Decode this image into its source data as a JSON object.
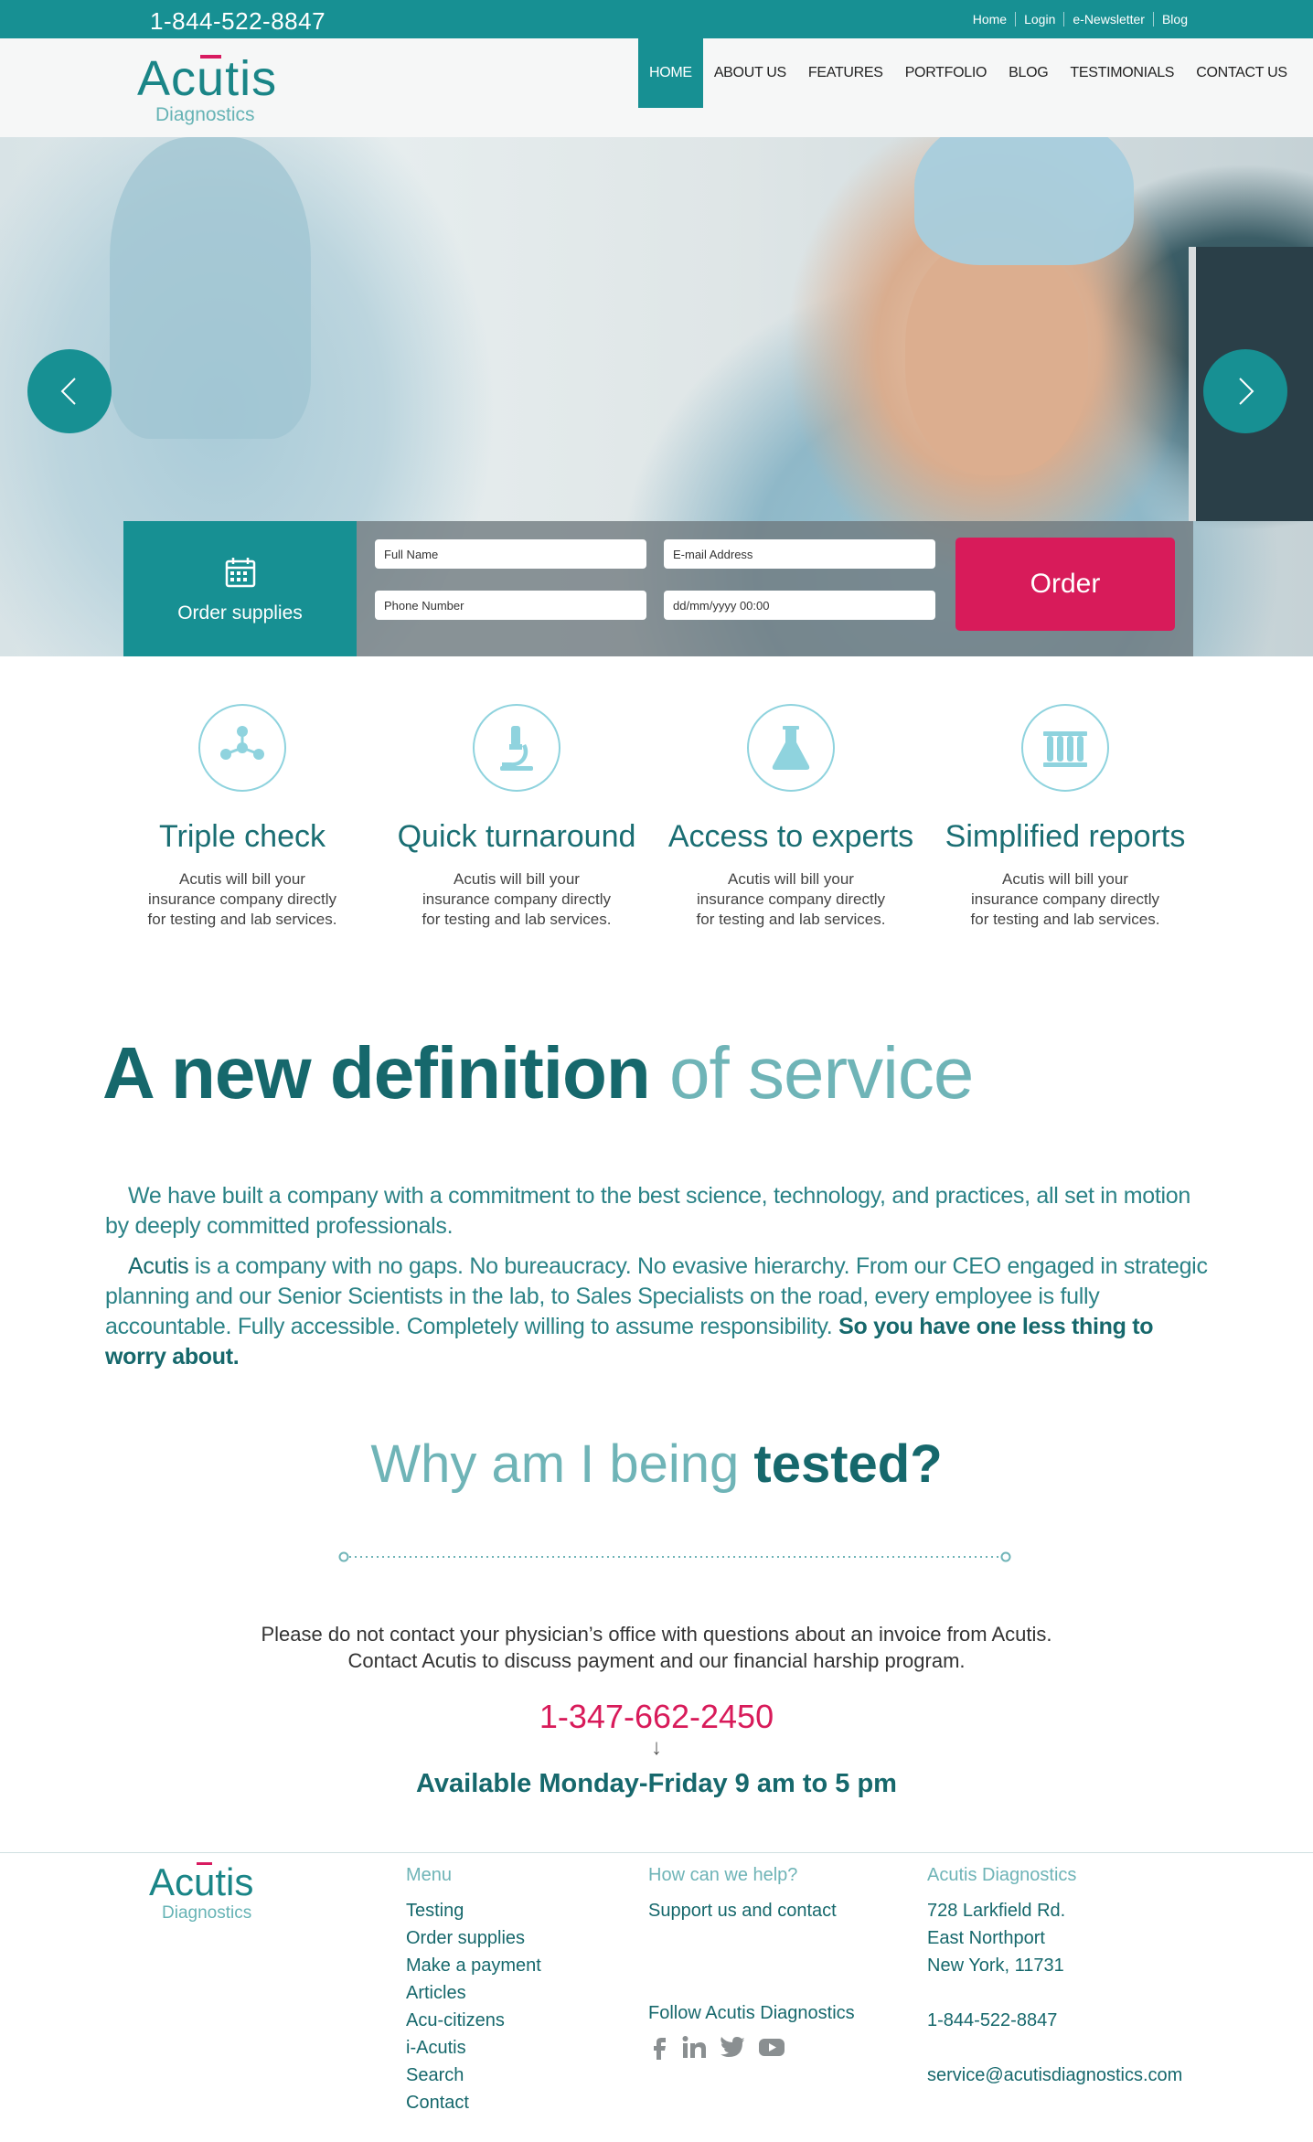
{
  "topbar": {
    "phone": "1-844-522-8847",
    "links": [
      "Home",
      "Login",
      "e-Newsletter",
      "Blog"
    ]
  },
  "header": {
    "logo_main": "Acūtis",
    "logo_sub": "Diagnostics",
    "nav": [
      "HOME",
      "ABOUT US",
      "FEATURES",
      "PORTFOLIO",
      "BLOG",
      "TESTIMONIALS",
      "CONTACT US"
    ],
    "active_nav": "HOME"
  },
  "hero": {
    "prev_icon": "chevron-left-icon",
    "next_icon": "chevron-right-icon",
    "order_tile": {
      "icon": "calendar-icon",
      "label": "Order supplies"
    },
    "fields": {
      "full_name": "Full Name",
      "email": "E-mail Address",
      "phone": "Phone Number",
      "datetime": "dd/mm/yyyy 00:00"
    },
    "order_button": "Order"
  },
  "features": [
    {
      "icon": "molecule-icon",
      "title": "Triple check",
      "desc": "Acutis will bill your insurance company directly for testing and lab services."
    },
    {
      "icon": "microscope-icon",
      "title": "Quick turnaround",
      "desc": "Acutis will bill your insurance company directly for testing and lab services."
    },
    {
      "icon": "flask-icon",
      "title": "Access to experts",
      "desc": "Acutis will bill your insurance company directly for testing and lab services."
    },
    {
      "icon": "test-tubes-icon",
      "title": "Simplified reports",
      "desc": "Acutis will bill your insurance company directly for testing and lab services."
    }
  ],
  "definition": {
    "title_strong": "A new definition",
    "title_light": "of service",
    "para1": "We have built a company with a commitment to the best science, technology, and practices, all set in motion by deeply committed professionals.",
    "para2_brand": "Acutis",
    "para2_body": " is a company with no gaps. No bureaucracy. No evasive hierarchy. From our CEO engaged in strategic planning and our Senior Scientists in the lab, to Sales Specialists on the road, every employee is fully accountable. Fully accessible. Completely willing to assume responsibility. ",
    "para2_end": "So you have one less thing to worry about."
  },
  "why": {
    "title_light": "Why am I being",
    "title_strong": "tested?",
    "line1": "Please do not contact your physician’s office with questions about an invoice from Acutis.",
    "line2": "Contact Acutis to discuss payment and our financial harship program.",
    "phone": "1-347-662-2450",
    "arrow": "↓",
    "availability": "Available Monday-Friday 9 am to 5 pm"
  },
  "footer": {
    "logo_main": "Acūtis",
    "logo_sub": "Diagnostics",
    "menu_heading": "Menu",
    "menu": [
      "Testing",
      "Order supplies",
      "Make a payment",
      "Articles",
      "Acu-citizens",
      "i-Acutis",
      "Search",
      "Contact"
    ],
    "help_heading": "How can we help?",
    "help_link": "Support us and contact",
    "follow_heading": "Follow Acutis Diagnostics",
    "social": [
      "facebook-icon",
      "linkedin-icon",
      "twitter-icon",
      "youtube-icon"
    ],
    "company_heading": "Acutis Diagnostics",
    "address": [
      "728 Larkfield Rd.",
      "East Northport",
      "New York, 11731"
    ],
    "phone": "1-844-522-8847",
    "email": "service@acutisdiagnostics.com"
  },
  "colors": {
    "teal": "#179093",
    "dark_teal": "#16686c",
    "light_teal": "#6fb4b7",
    "accent_pink": "#d81b5a"
  }
}
